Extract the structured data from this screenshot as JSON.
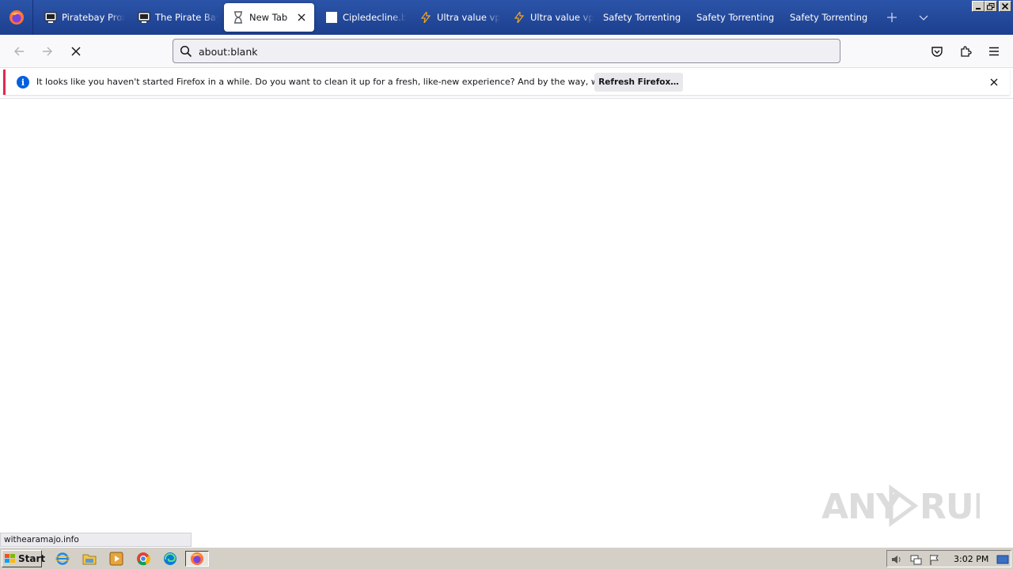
{
  "browser": {
    "tabs": [
      {
        "label": "Piratebay Proxy",
        "icon": "monitor-icon",
        "active": false
      },
      {
        "label": "The Pirate Bay",
        "icon": "monitor-icon",
        "active": false
      },
      {
        "label": "New Tab",
        "icon": "hourglass-icon",
        "active": true
      },
      {
        "label": "Cipledecline.buzz",
        "icon": "blank-page-icon",
        "active": false
      },
      {
        "label": "Ultra value vpn",
        "icon": "bolt-icon",
        "active": false
      },
      {
        "label": "Ultra value vpn",
        "icon": "bolt-icon",
        "active": false
      },
      {
        "label": "Safety Torrenting",
        "icon": "none",
        "active": false
      },
      {
        "label": "Safety Torrenting",
        "icon": "none",
        "active": false
      },
      {
        "label": "Safety Torrenting",
        "icon": "none",
        "active": false
      }
    ],
    "url": "about:blank",
    "notification": {
      "message": "It looks like you haven't started Firefox in a while. Do you want to clean it up for a fresh, like-new experience? And by the way, welcome back!",
      "button": "Refresh Firefox…"
    },
    "status_url": "withearamajo.info"
  },
  "taskbar": {
    "start_label": "Start",
    "clock": "3:02 PM"
  },
  "watermark": "ANY RUN",
  "colors": {
    "titlebar": "#2b54a8",
    "accent": "#0060df",
    "notification_border": "#e22850"
  }
}
